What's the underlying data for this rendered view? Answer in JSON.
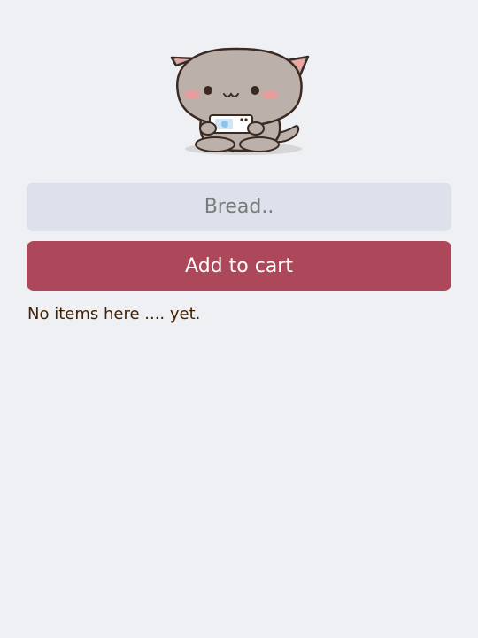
{
  "mascot": {
    "icon": "cat-holding-phone-icon"
  },
  "input": {
    "placeholder": "Bread..",
    "value": ""
  },
  "add_button": {
    "label": "Add to cart"
  },
  "list": {
    "empty_message": "No items here .... yet."
  },
  "colors": {
    "background": "#eef0f4",
    "input_background": "#dce1eb",
    "button_background": "#ac485a",
    "button_text": "#fdfdfd",
    "text": "#432000"
  }
}
